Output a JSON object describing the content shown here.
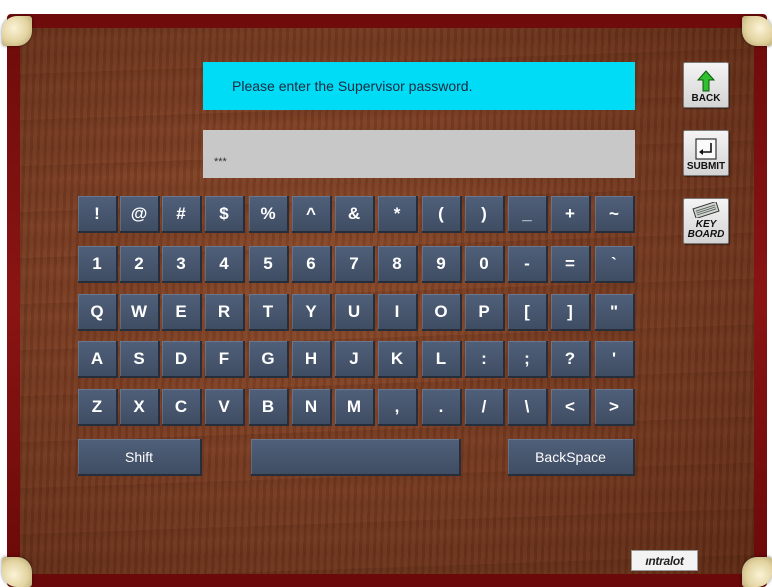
{
  "prompt": {
    "text": "Please enter the Supervisor password."
  },
  "password": {
    "value": "***"
  },
  "side_buttons": {
    "back": {
      "label": "BACK",
      "icon": "green-up-arrow-icon"
    },
    "submit": {
      "label": "SUBMIT",
      "icon": "enter-key-icon"
    },
    "keyboard": {
      "label_line1": "KEY",
      "label_line2": "BOARD",
      "icon": "keyboard-icon"
    }
  },
  "keys": {
    "row1": [
      "!",
      "@",
      "#",
      "$",
      "%",
      "^",
      "&",
      "*",
      "(",
      ")",
      "_",
      "+",
      "~"
    ],
    "row2": [
      "1",
      "2",
      "3",
      "4",
      "5",
      "6",
      "7",
      "8",
      "9",
      "0",
      "-",
      "=",
      "`"
    ],
    "row3": [
      "Q",
      "W",
      "E",
      "R",
      "T",
      "Y",
      "U",
      "I",
      "O",
      "P",
      "[",
      "]",
      "\""
    ],
    "row4": [
      "A",
      "S",
      "D",
      "F",
      "G",
      "H",
      "J",
      "K",
      "L",
      ":",
      ";",
      "?",
      "'"
    ],
    "row5": [
      "Z",
      "X",
      "C",
      "V",
      "B",
      "N",
      "M",
      ",",
      ".",
      "/",
      "\\",
      "<",
      ">"
    ]
  },
  "bottom_row": {
    "shift": "Shift",
    "space": "",
    "backspace": "BackSpace"
  },
  "logo": {
    "text": "ıntralot"
  },
  "colors": {
    "prompt_bg": "#00dcf5",
    "field_bg": "#c8c8c8",
    "key_bg": "#46556c",
    "frame": "#7a0f0f",
    "wood": "#7a3d22"
  }
}
